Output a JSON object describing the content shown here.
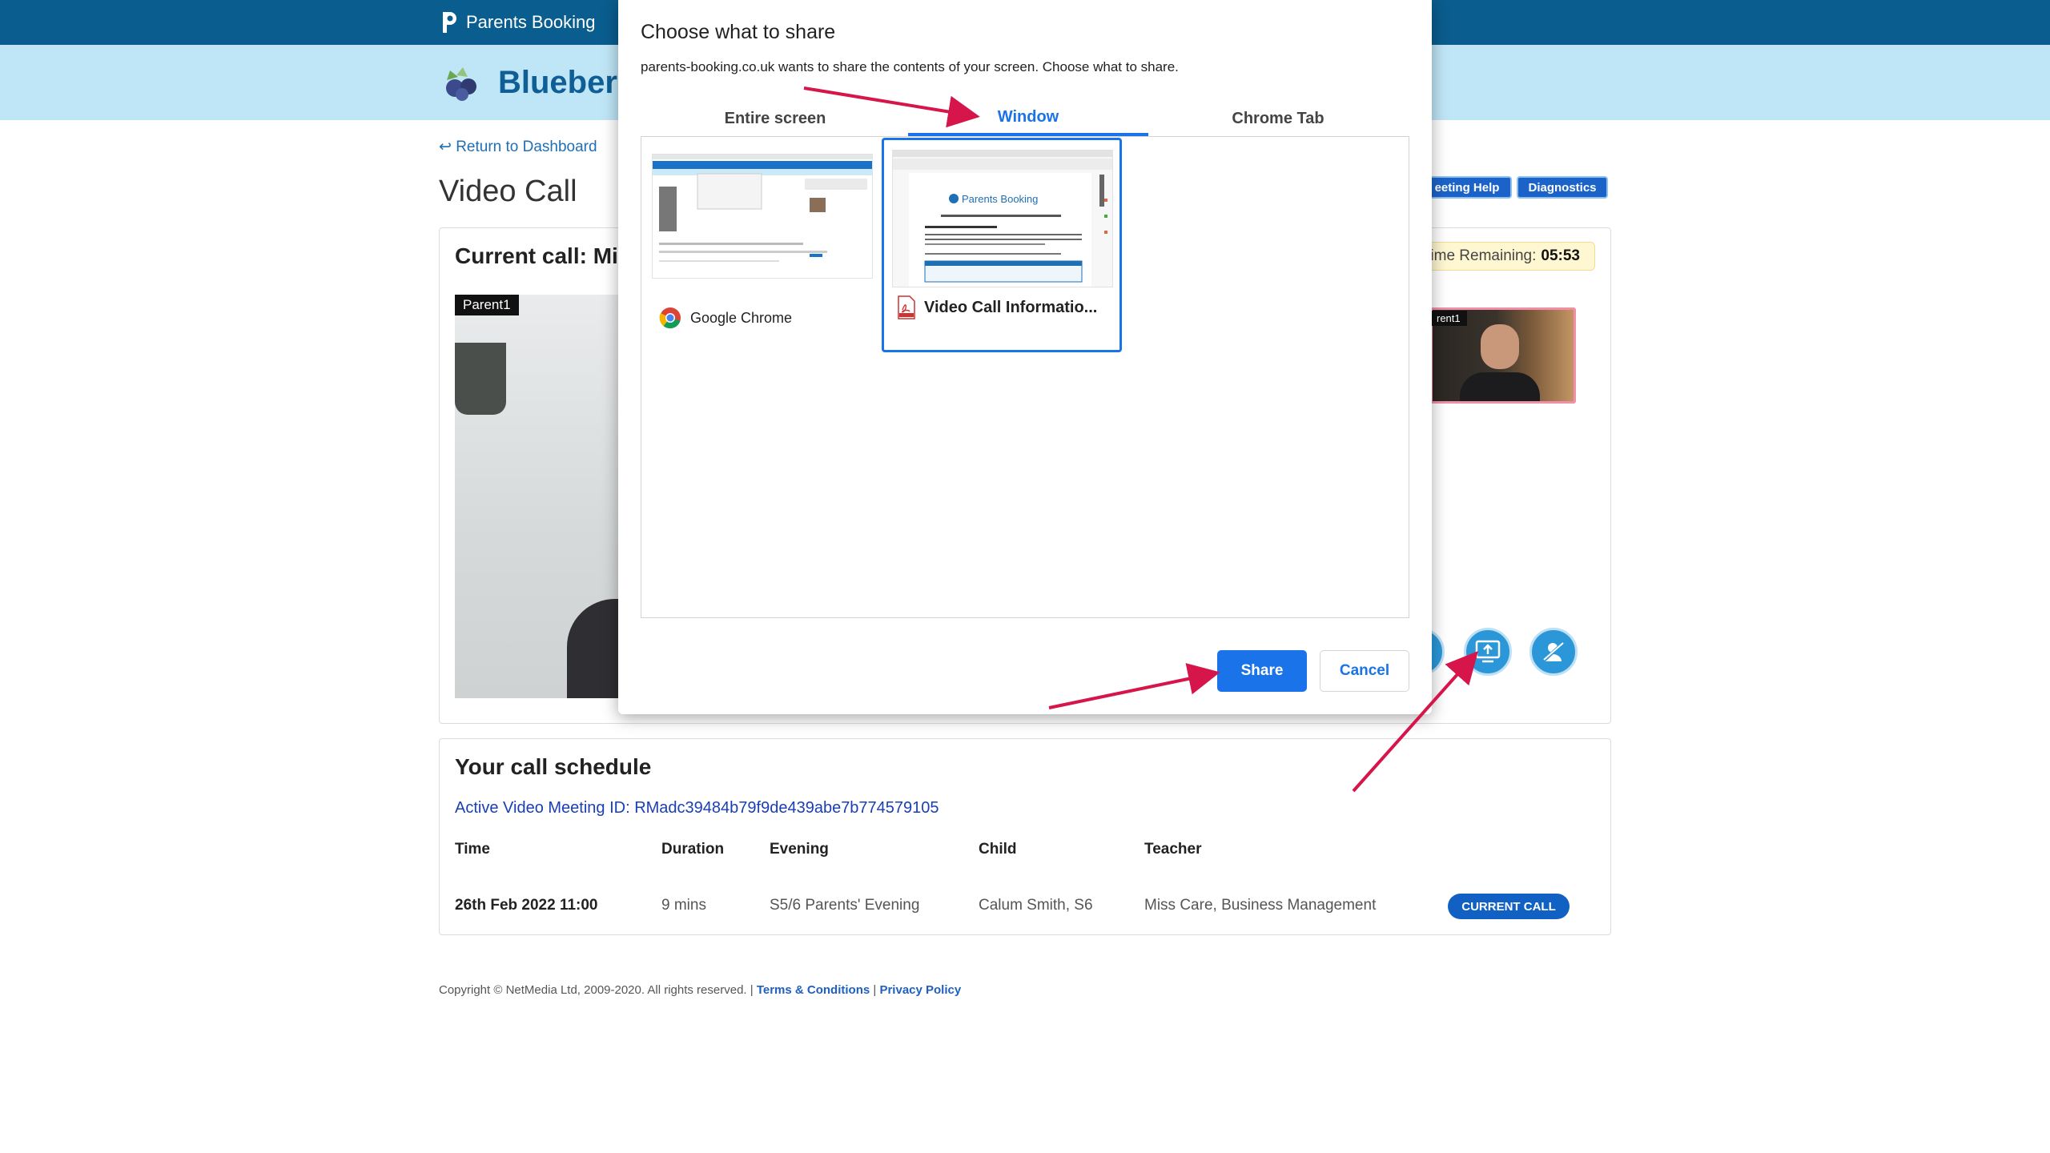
{
  "header": {
    "brand": "Parents Booking",
    "school_name": "Blueberr"
  },
  "nav": {
    "return_link": "↩ Return to Dashboard"
  },
  "page": {
    "title": "Video Call"
  },
  "toolbar": {
    "meeting_help": "eeting Help",
    "diagnostics": "Diagnostics"
  },
  "call": {
    "current_call": "Current call: Mis",
    "time_remaining_label": "ime Remaining:",
    "time_remaining_value": "05:53",
    "remote_tag": "Parent1",
    "self_tag": "rent1",
    "controls": [
      "microphone-icon",
      "screen-share-icon",
      "camera-off-icon"
    ]
  },
  "schedule": {
    "title": "Your call schedule",
    "meeting_id": "Active Video Meeting ID: RMadc39484b79f9de439abe7b774579105",
    "columns": [
      "Time",
      "Duration",
      "Evening",
      "Child",
      "Teacher"
    ],
    "rows": [
      {
        "time": "26th Feb 2022 11:00",
        "duration": "9 mins",
        "evening": "S5/6 Parents' Evening",
        "child": "Calum Smith, S6",
        "teacher": "Miss Care, Business Management",
        "status": "CURRENT CALL"
      }
    ]
  },
  "footer": {
    "copyright": "Copyright © NetMedia Ltd, 2009-2020. All rights reserved. | ",
    "terms": "Terms & Conditions",
    "separator": " | ",
    "privacy": "Privacy Policy"
  },
  "dialog": {
    "title": "Choose what to share",
    "subtitle": "parents-booking.co.uk wants to share the contents of your screen. Choose what to share.",
    "tabs": [
      {
        "label": "Entire screen"
      },
      {
        "label": "Window"
      },
      {
        "label": "Chrome Tab"
      }
    ],
    "selected_tab": "Window",
    "sources": [
      {
        "label": "Google Chrome",
        "icon": "chrome-icon"
      },
      {
        "label": "Video Call Informatio...",
        "icon": "pdf-icon",
        "thumb_text": "Parents Booking"
      }
    ],
    "share_button": "Share",
    "cancel_button": "Cancel"
  },
  "colors": {
    "topbar": "#0a5d8f",
    "subbar": "#bfe6f7",
    "accent": "#1a73e8",
    "annotation_arrow": "#d6154b"
  }
}
